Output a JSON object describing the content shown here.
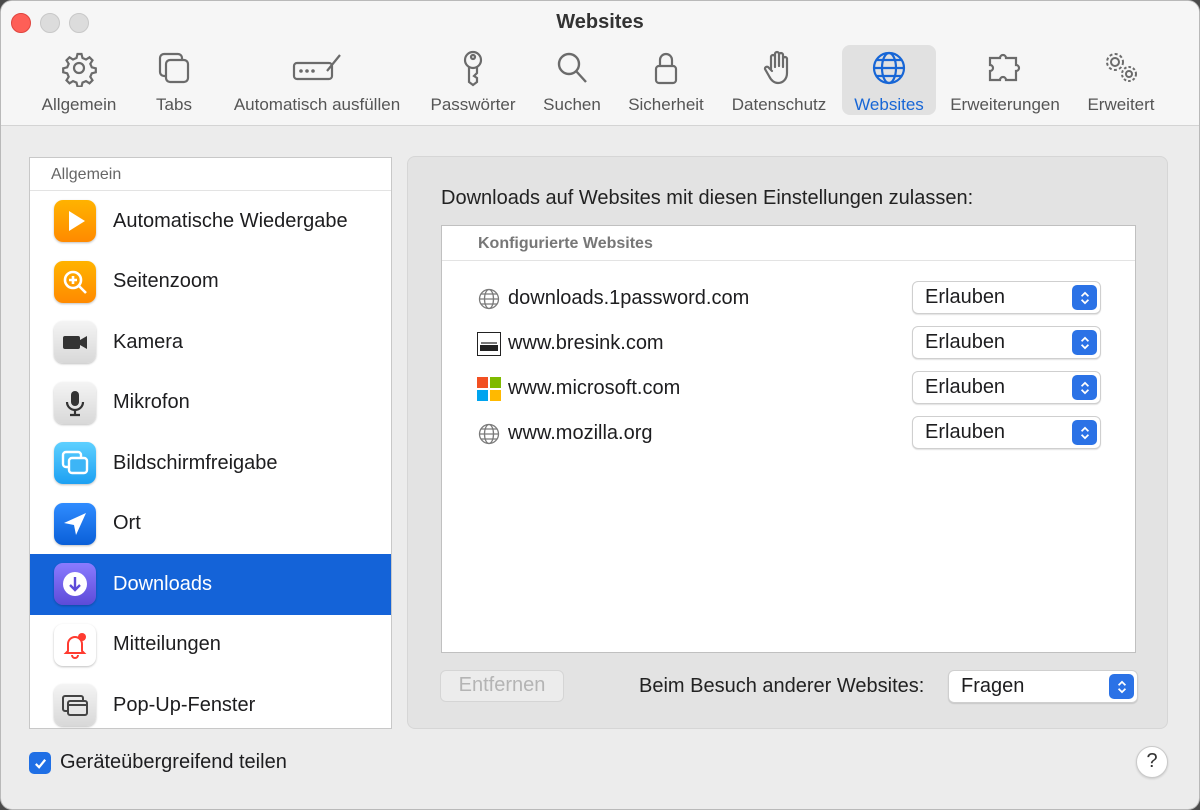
{
  "window": {
    "title": "Websites"
  },
  "toolbar": {
    "items": [
      {
        "label": "Allgemein",
        "icon": "gear-icon"
      },
      {
        "label": "Tabs",
        "icon": "tabs-icon"
      },
      {
        "label": "Automatisch ausfüllen",
        "icon": "autofill-icon"
      },
      {
        "label": "Passwörter",
        "icon": "key-icon"
      },
      {
        "label": "Suchen",
        "icon": "search-icon"
      },
      {
        "label": "Sicherheit",
        "icon": "lock-icon"
      },
      {
        "label": "Datenschutz",
        "icon": "hand-icon"
      },
      {
        "label": "Websites",
        "icon": "globe-icon",
        "active": true
      },
      {
        "label": "Erweiterungen",
        "icon": "puzzle-icon"
      },
      {
        "label": "Erweitert",
        "icon": "gears-icon"
      }
    ]
  },
  "sidebar": {
    "header": "Allgemein",
    "items": [
      {
        "label": "Automatische Wiedergabe",
        "icon": "play-icon"
      },
      {
        "label": "Seitenzoom",
        "icon": "zoom-icon"
      },
      {
        "label": "Kamera",
        "icon": "camera-icon"
      },
      {
        "label": "Mikrofon",
        "icon": "microphone-icon"
      },
      {
        "label": "Bildschirmfreigabe",
        "icon": "screen-share-icon"
      },
      {
        "label": "Ort",
        "icon": "location-icon"
      },
      {
        "label": "Downloads",
        "icon": "download-icon",
        "selected": true
      },
      {
        "label": "Mitteilungen",
        "icon": "bell-icon"
      },
      {
        "label": "Pop-Up-Fenster",
        "icon": "popup-window-icon"
      }
    ]
  },
  "main": {
    "heading": "Downloads auf Websites mit diesen Einstellungen zulassen:",
    "table_header": "Konfigurierte Websites",
    "sites": [
      {
        "name": "downloads.1password.com",
        "icon": "globe-icon",
        "setting": "Erlauben"
      },
      {
        "name": "www.bresink.com",
        "icon": "bresink-logo-icon",
        "setting": "Erlauben"
      },
      {
        "name": "www.microsoft.com",
        "icon": "microsoft-logo-icon",
        "setting": "Erlauben"
      },
      {
        "name": "www.mozilla.org",
        "icon": "globe-icon",
        "setting": "Erlauben"
      }
    ],
    "remove_button": "Entfernen",
    "other_sites_label": "Beim Besuch anderer Websites:",
    "other_sites_value": "Fragen"
  },
  "footer": {
    "share_label": "Geräteübergreifend teilen",
    "share_checked": true,
    "help": "?"
  },
  "colors": {
    "accent": "#1463d8",
    "close_button": "#fe5f57",
    "active_tab_label": "#1766d6"
  }
}
